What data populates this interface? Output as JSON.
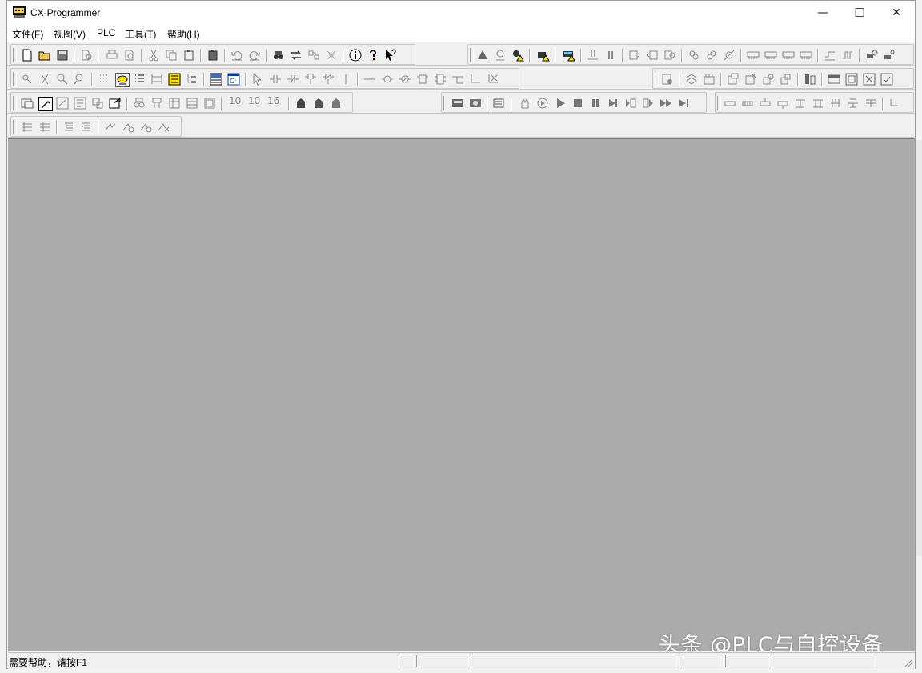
{
  "window": {
    "title": "CX-Programmer",
    "minimize_glyph": "—",
    "maximize_glyph": "☐",
    "close_glyph": "✕"
  },
  "menu": [
    {
      "label": "文件(F)"
    },
    {
      "label": "视图(V)"
    },
    {
      "label": "PLC"
    },
    {
      "label": "工具(T)"
    },
    {
      "label": "帮助(H)"
    }
  ],
  "statusbar": {
    "help_text": "需要帮助，请按F1"
  },
  "watermark": {
    "text": "头条 @PLC与自控设备"
  },
  "toolbar": {
    "row3_labels": [
      "10",
      "10",
      "16"
    ]
  },
  "colors": {
    "workspace": "#ababab",
    "chrome": "#f0f0f0",
    "accent_yellow": "#ffe000"
  }
}
